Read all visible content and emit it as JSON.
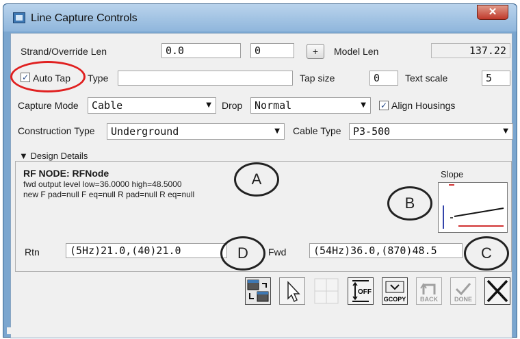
{
  "window": {
    "title": "Line Capture Controls",
    "close_glyph": "✕"
  },
  "strand": {
    "label": "Strand/Override Len",
    "value1": "0.0",
    "value2": "0",
    "plus_label": "+",
    "model_len_label": "Model Len",
    "model_len_value": "137.22"
  },
  "tap": {
    "auto_tap_label": "Auto Tap",
    "auto_tap_checked": true,
    "type_label": "Type",
    "type_value": "",
    "tap_size_label": "Tap size",
    "tap_size_value": "0",
    "text_scale_label": "Text scale",
    "text_scale_value": "5"
  },
  "capture": {
    "mode_label": "Capture Mode",
    "mode_value": "Cable",
    "drop_label": "Drop",
    "drop_value": "Normal",
    "align_label": "Align Housings",
    "align_checked": true
  },
  "construction": {
    "type_label": "Construction Type",
    "type_value": "Underground",
    "cable_type_label": "Cable Type",
    "cable_type_value": "P3-500"
  },
  "design": {
    "section_label": "Design Details",
    "node_title": "RF NODE: RFNode",
    "line1": "fwd output level low=36.0000 high=48.5000",
    "line2": "new F pad=null F eq=null R pad=null R eq=null",
    "slope_label": "Slope",
    "rtn_label": "Rtn",
    "rtn_value": "(5Hz)21.0,(40)21.0",
    "fwd_label": "Fwd",
    "fwd_value": "(54Hz)36.0,(870)48.5"
  },
  "callouts": {
    "a": "A",
    "b": "B",
    "c": "C",
    "d": "D"
  },
  "toolbar": {
    "off_label": "OFF",
    "gcopy_label": "GCOPY",
    "back_label": "BACK",
    "done_label": "DONE"
  },
  "colors": {
    "highlight_ring": "#e02020",
    "accent": "#3e78b3"
  }
}
